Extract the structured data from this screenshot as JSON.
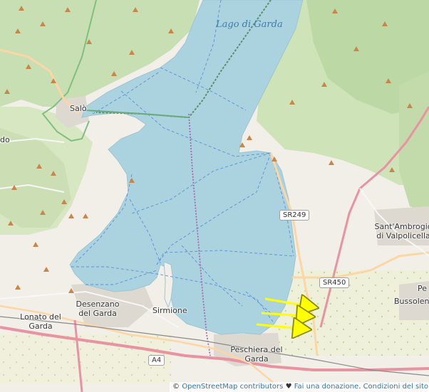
{
  "map": {
    "lake_label": "Lago di Garda",
    "places": {
      "salo": "Salò",
      "desenzano_1": "Desenzano",
      "desenzano_2": "del Garda",
      "sirmione": "Sirmione",
      "lonato_1": "Lonato del",
      "lonato_2": "Garda",
      "peschiera_1": "Peschiera del",
      "peschiera_2": "Garda",
      "santambrogio_1": "Sant'Ambrogio",
      "santambrogio_2": "di Valpolicella",
      "bussolengo_1": "Pe",
      "bussolengo_2": "Bussolen",
      "edge_left": "do"
    },
    "roads": {
      "sr249": "SR249",
      "sr450": "SR450",
      "a4": "A4"
    },
    "annotation_arrow_count": 3
  },
  "attribution": {
    "leaflet_icon": "leaflet-flag-icon",
    "osm_link": "OpenStreetMap contributors",
    "heart": "♥",
    "donate": "Fai una donazione",
    "separator": ".",
    "terms": "Condizioni del sito we"
  },
  "colors": {
    "water": "#aad3df",
    "forest": "#add19e",
    "land": "#f2efe9",
    "motorway": "#e892a2",
    "primary": "#fcd6a4",
    "annotation": "#ffff00"
  }
}
